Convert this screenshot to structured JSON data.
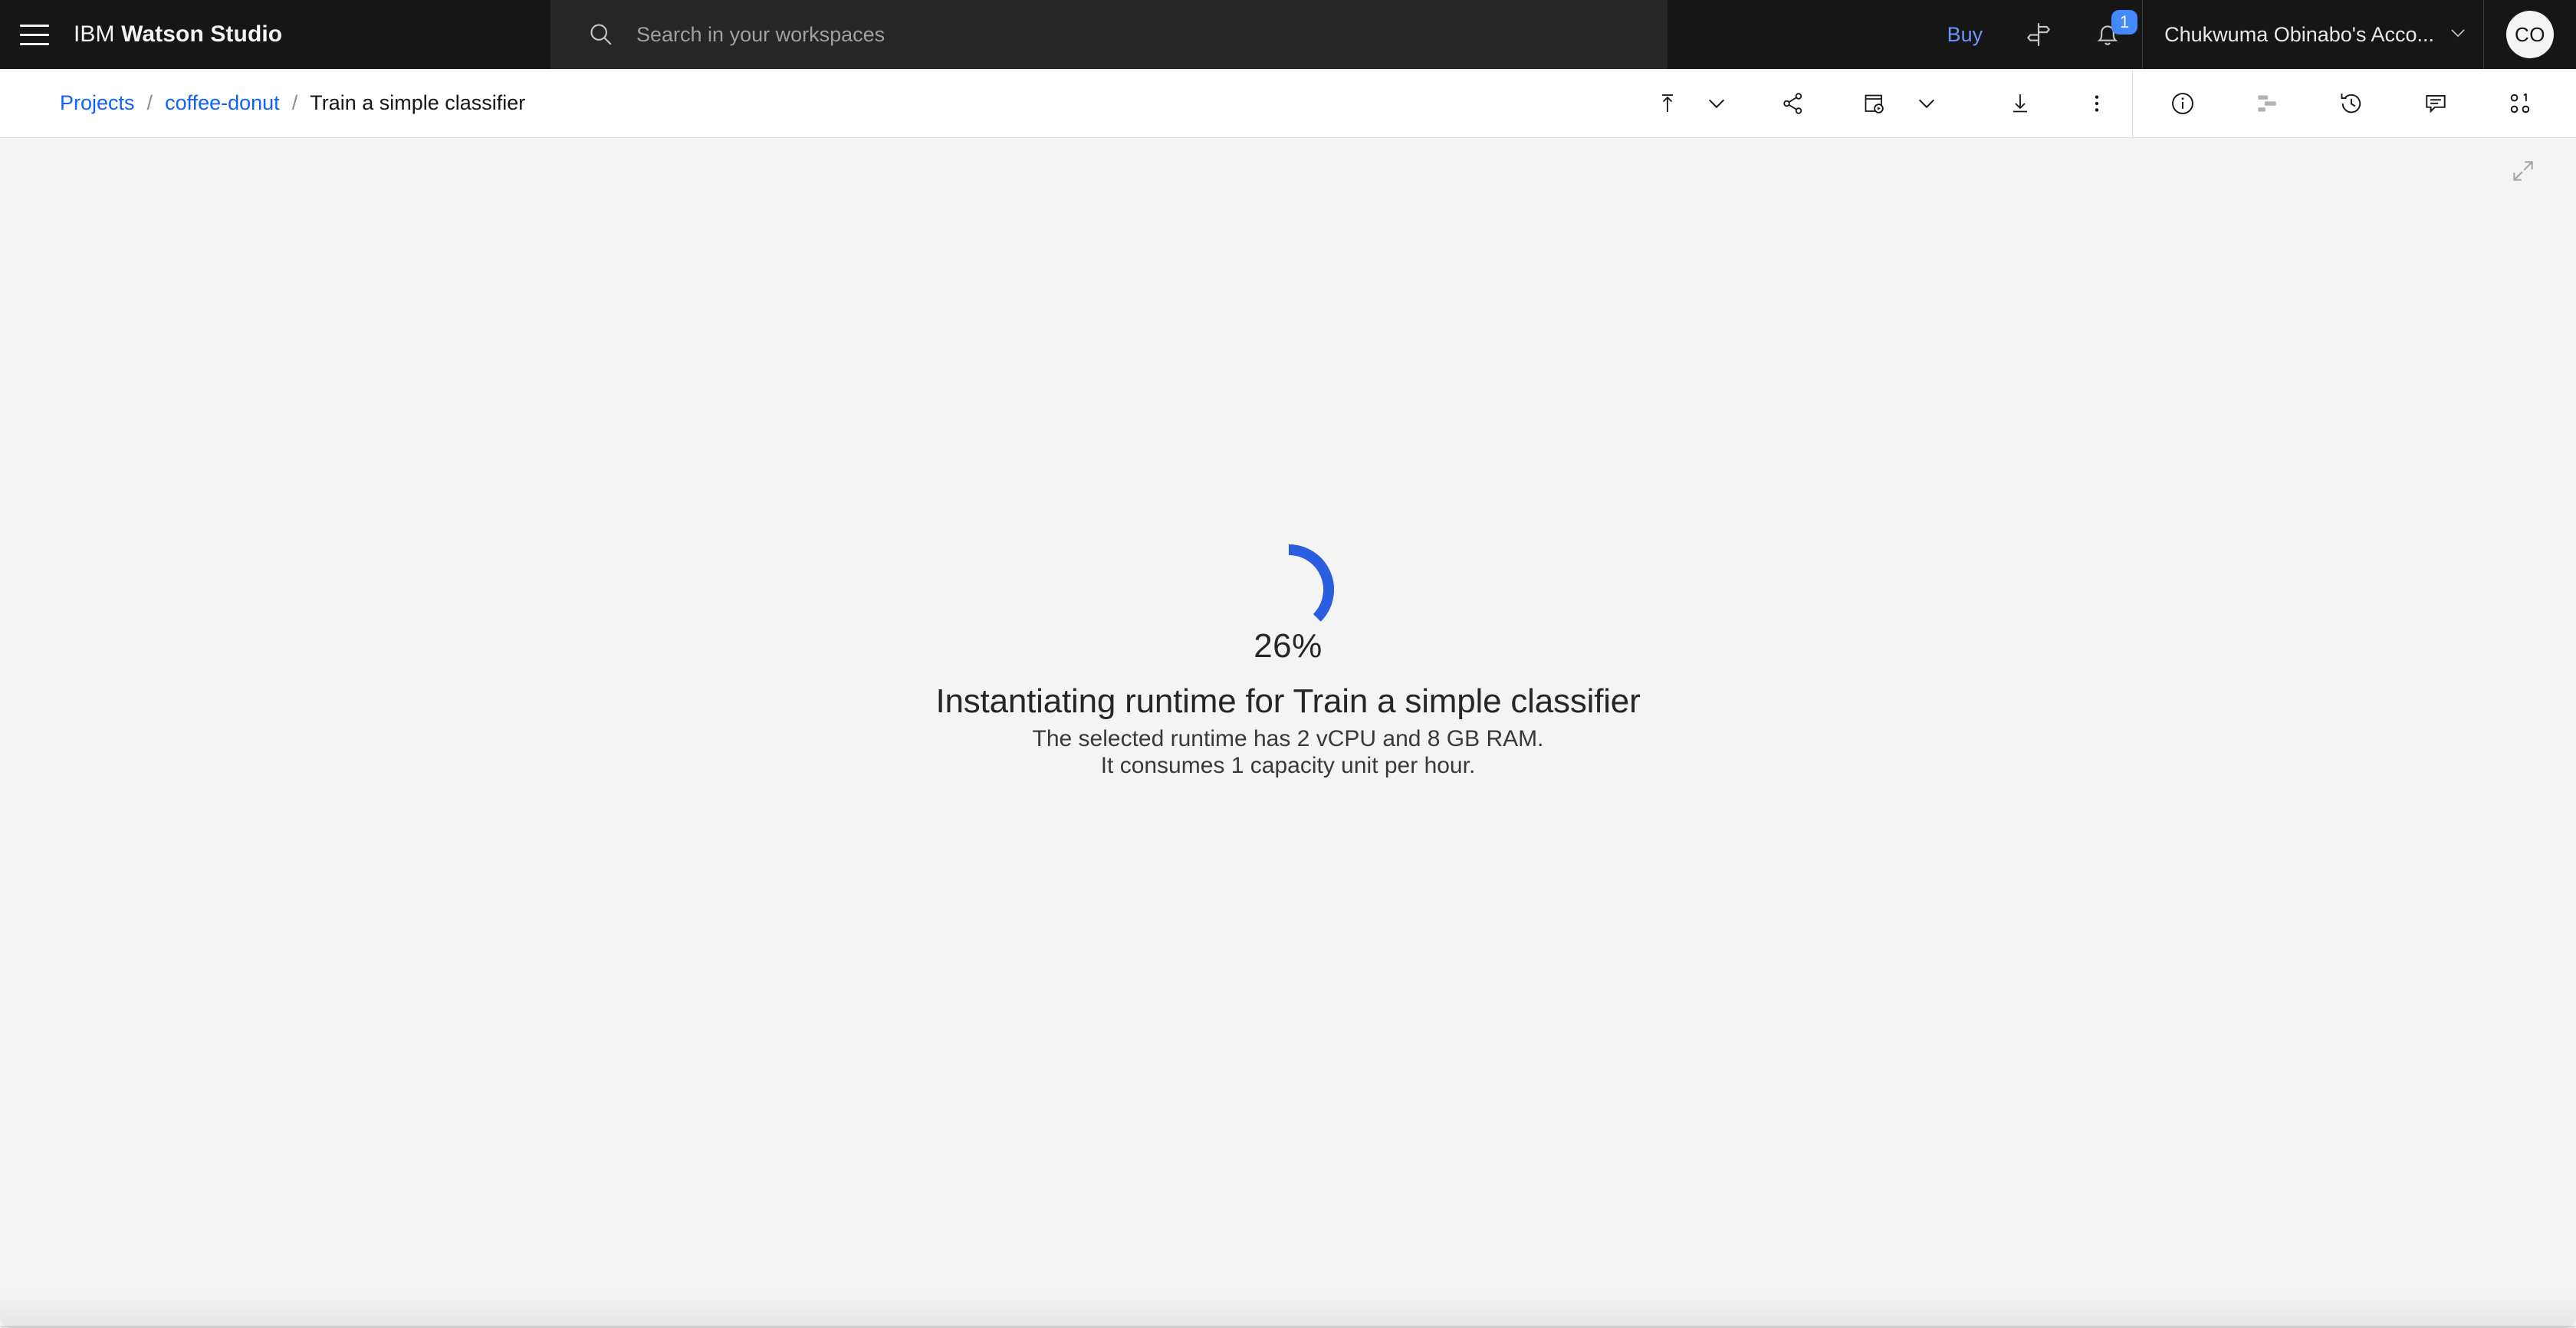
{
  "header": {
    "menu_icon": "hamburger-menu-icon",
    "brand_prefix": "IBM",
    "brand_name": "Watson Studio",
    "search": {
      "icon": "search-icon",
      "placeholder": "Search in your workspaces",
      "value": ""
    },
    "buy_label": "Buy",
    "signpost_icon": "signpost-icon",
    "notifications": {
      "icon": "notification-bell-icon",
      "badge_count": "1",
      "badge_color": "#4589ff"
    },
    "account": {
      "name": "Chukwuma Obinabo's Acco...",
      "chevron_icon": "chevron-down-icon"
    },
    "avatar": {
      "initials": "CO"
    },
    "background_color": "#161616",
    "search_background_color": "#262626"
  },
  "subbar": {
    "breadcrumb": {
      "items": [
        {
          "label": "Projects",
          "is_link": true
        },
        {
          "label": "coffee-donut",
          "is_link": true
        },
        {
          "label": "Train a simple classifier",
          "is_link": false
        }
      ],
      "separator": "/",
      "link_color": "#0f62fe"
    },
    "toolbar": [
      {
        "name": "export-icon",
        "tooltip": "Export"
      },
      {
        "name": "chevron-down-icon",
        "tooltip": "Export options"
      },
      {
        "name": "share-icon",
        "tooltip": "Share"
      },
      {
        "name": "run-slideshow-icon",
        "tooltip": "Run"
      },
      {
        "name": "chevron-down-icon",
        "tooltip": "Run options"
      },
      {
        "name": "download-icon",
        "tooltip": "Download"
      },
      {
        "name": "overflow-menu-icon",
        "tooltip": "More actions"
      }
    ],
    "panel_toolbar": [
      {
        "name": "information-icon",
        "tooltip": "Information",
        "disabled": false
      },
      {
        "name": "data-panel-icon",
        "tooltip": "Data",
        "disabled": true
      },
      {
        "name": "version-history-icon",
        "tooltip": "Version history",
        "disabled": false
      },
      {
        "name": "comments-icon",
        "tooltip": "Comments",
        "disabled": false
      },
      {
        "name": "collaborators-icon",
        "tooltip": "Collaborators",
        "disabled": false
      }
    ]
  },
  "main": {
    "expand_icon": "expand-maximize-icon",
    "loader": {
      "progress_percent": "26%",
      "progress_value": 26,
      "arc_color": "#2a5de0",
      "title": "Instantiating runtime for Train a simple classifier",
      "subtitle_line1": "The selected runtime has 2 vCPU and 8 GB RAM.",
      "subtitle_line2": "It consumes 1 capacity unit per hour."
    },
    "background_color": "#f4f4f4"
  }
}
